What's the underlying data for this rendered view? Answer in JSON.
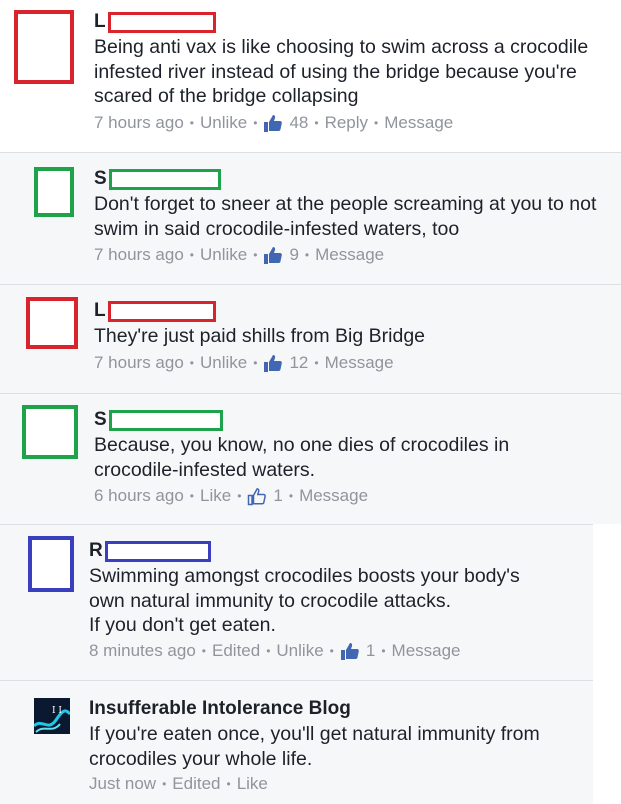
{
  "comments": [
    {
      "initial": "L",
      "text": "Being anti vax is like choosing to swim across a crocodile infested river instead of using the bridge because you're scared of the bridge collapsing",
      "time": "7 hours ago",
      "like_label": "Unlike",
      "likes": "48",
      "reply": "Reply",
      "message": "Message"
    },
    {
      "initial": "S",
      "text": "Don't forget to sneer at the people screaming at you to not swim in said crocodile-infested waters, too",
      "time": "7 hours ago",
      "like_label": "Unlike",
      "likes": "9",
      "message": "Message"
    },
    {
      "initial": "L",
      "text": "They're just paid shills from Big Bridge",
      "time": "7 hours ago",
      "like_label": "Unlike",
      "likes": "12",
      "message": "Message"
    },
    {
      "initial": "S",
      "text": "Because, you know, no one dies of crocodiles in crocodile-infested waters.",
      "time": "6 hours ago",
      "like_label": "Like",
      "likes": "1",
      "message": "Message"
    },
    {
      "initial": "R",
      "text_lines": [
        "Swimming amongst crocodiles boosts your body's",
        "own natural immunity to crocodile attacks.",
        "If you don't get eaten."
      ],
      "time": "8 minutes ago",
      "edited": "Edited",
      "like_label": "Unlike",
      "likes": "1",
      "message": "Message"
    },
    {
      "author": "Insufferable Intolerance Blog",
      "text": "If you're eaten once, you'll get natural immunity from crocodiles your whole life.",
      "time": "Just now",
      "edited": "Edited",
      "like_label": "Like"
    }
  ],
  "colors": {
    "red": "#d9232d",
    "green": "#1fa34a",
    "blue": "#3a3fbf",
    "meta": "#90949c",
    "like_blue": "#4267b2"
  }
}
